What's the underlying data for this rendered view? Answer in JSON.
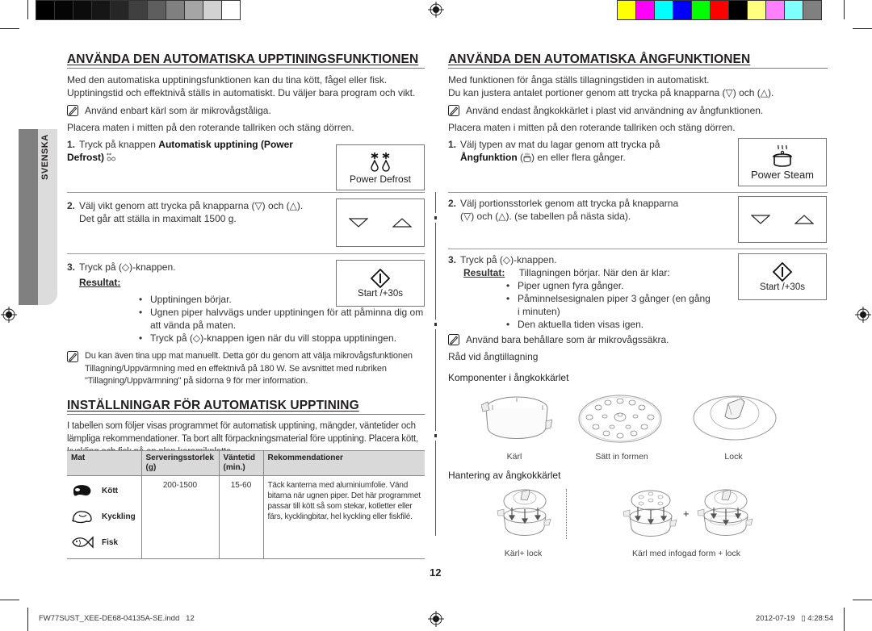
{
  "print_marks": {
    "gray_swatches": [
      "#000000",
      "#050505",
      "#0c0c0c",
      "#161616",
      "#262626",
      "#404040",
      "#5e5e5e",
      "#808080",
      "#a5a5a5",
      "#d2d2d2",
      "#ffffff"
    ],
    "color_swatches": [
      "#ffff00",
      "#ff00ff",
      "#00ffff",
      "#0000ff",
      "#00ff00",
      "#ff0000",
      "#000000",
      "#ffff80",
      "#ff80ff",
      "#80ffff",
      "#808080"
    ]
  },
  "side_tab": {
    "label": "SVENSKA"
  },
  "left": {
    "title": "ANVÄNDA DEN AUTOMATISKA UPPTININGSFUNKTIONEN",
    "intro": "Med den automatiska upptiningsfunktionen kan du tina kött, fågel eller fisk. Upptiningstid och effektnivå ställs in automatiskt. Du väljer bara program och vikt.",
    "note1": "Använd enbart kärl som är mikrovågståliga.",
    "place": "Placera maten i mitten på den roterande tallriken och stäng dörren.",
    "step1": {
      "num": "1.",
      "pre": "Tryck på knappen ",
      "bold": "Automatisk upptining (Power Defrost)",
      "icon_inline": "defrost-icon",
      "panel_label": "Power Defrost"
    },
    "step2": {
      "num": "2.",
      "line1": "Välj vikt genom att trycka på knapparna (▽) och (△).",
      "line2": "Det går att ställa in maximalt 1500 g."
    },
    "step3": {
      "num": "3.",
      "text": "Tryck på (◇)-knappen.",
      "result_label": "Resultat:",
      "panel_label": "Start /+30s",
      "bullets": [
        "Upptiningen börjar.",
        "Ugnen piper halvvägs under upptiningen för att påminna dig om att vända på maten.",
        "Tryck på (◇)-knappen igen när du vill stoppa upptiningen."
      ]
    },
    "note2": "Du kan även tina upp mat manuellt. Detta gör du genom att välja mikrovågsfunktionen Tillagning/Uppvärmning med en effektnivå på 180 W. Se avsnittet med rubriken \"Tillagning/Uppvärmning\" på sidorna 9 för mer information.",
    "settings_title": "INSTÄLLNINGAR FÖR AUTOMATISK UPPTINING",
    "settings_intro": "I tabellen som följer visas programmet för automatisk upptining, mängder, väntetider och lämpliga rekommendationer. Ta bort allt förpackningsmaterial före upptining. Placera kött, kyckling och fisk på en plan keramikplatta.",
    "table": {
      "headers": [
        "Mat",
        "Serveringsstorlek (g)",
        "Väntetid (min.)",
        "Rekommendationer"
      ],
      "foods": [
        {
          "name": "Kött",
          "icon": "meat-icon"
        },
        {
          "name": "Kyckling",
          "icon": "chicken-icon"
        },
        {
          "name": "Fisk",
          "icon": "fish-icon"
        }
      ],
      "serving": "200-1500",
      "wait": "15-60",
      "recommendation": "Täck kanterna med aluminiumfolie. Vänd bitarna när ugnen piper. Det här programmet passar till kött så som stekar, kotletter eller färs, kycklingbitar, hel kyckling eller fiskfilé."
    }
  },
  "right": {
    "title": "ANVÄNDA DEN AUTOMATISKA ÅNGFUNKTIONEN",
    "intro1": "Med funktionen för ånga ställs tillagningstiden in automatiskt.",
    "intro2": "Du kan justera antalet portioner genom att trycka på knapparna (▽) och (△).",
    "note1": "Använd endast ångkokkärlet i plast vid användning av ångfunktionen.",
    "place": "Placera maten i mitten på den roterande tallriken och stäng dörren.",
    "step1": {
      "num": "1.",
      "line1": "Välj typen av mat du lagar genom att trycka på",
      "bold": "Ångfunktion",
      "line2_rest": ") en eller flera gånger.",
      "panel_label": "Power Steam"
    },
    "step2": {
      "num": "2.",
      "line1": "Välj portionsstorlek genom att trycka på knapparna",
      "line2": "(▽) och (△). (se tabellen på nästa sida)."
    },
    "step3": {
      "num": "3.",
      "text": "Tryck på (◇)-knappen.",
      "result_label": "Resultat:",
      "result_text": "Tillagningen börjar. När den är klar:",
      "panel_label": "Start /+30s",
      "bullets": [
        "Piper ugnen fyra gånger.",
        "Påminnelsesignalen piper 3 gånger (en gång i minuten)",
        "Den aktuella tiden visas igen."
      ]
    },
    "note2": "Använd bara behållare som är mikrovågssäkra.",
    "advice": "Råd vid ångtillagning",
    "components_title": "Komponenter i ångkokkärlet",
    "components": [
      "Kärl",
      "Sätt in formen",
      "Lock"
    ],
    "handling_title": "Hantering av ångkokkärlet",
    "handling": [
      "Kärl+ lock",
      "Kärl med infogad form + lock"
    ],
    "plus": "+"
  },
  "page_number": "12",
  "footer": {
    "file": "FW77SUST_XEE-DE68-04135A-SE.indd   12",
    "date": "2012-07-19   ▯ 4:28:54"
  }
}
